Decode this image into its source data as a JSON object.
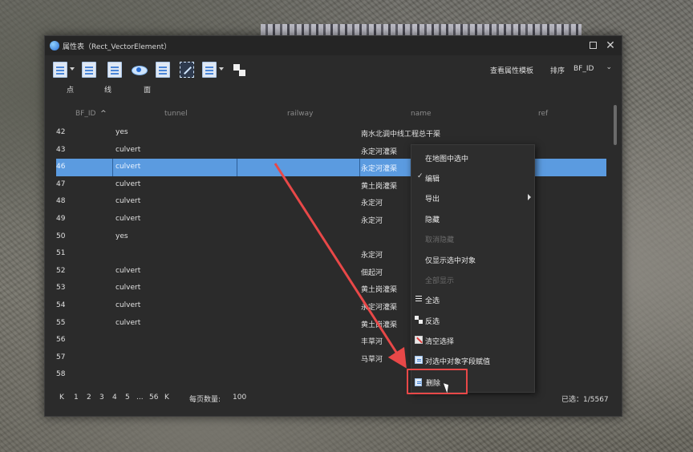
{
  "window": {
    "title": "属性表（Rect_VectorElement）"
  },
  "toolbar": {
    "labels": {
      "point": "点",
      "line": "线",
      "polygon": "面"
    },
    "view_template": "查看属性模板",
    "sort_label": "排序",
    "sort_field": "BF_ID"
  },
  "table": {
    "headers": [
      "BF_ID",
      "tunnel",
      "railway",
      "name",
      "ref"
    ],
    "rows": [
      {
        "id": "42",
        "tunnel": "yes",
        "name": "南水北调中线工程总干渠"
      },
      {
        "id": "43",
        "tunnel": "culvert",
        "name": "永定河灌渠"
      },
      {
        "id": "46",
        "tunnel": "culvert",
        "name": "永定河灌渠",
        "selected": true
      },
      {
        "id": "47",
        "tunnel": "culvert",
        "name": "黄土岗灌渠"
      },
      {
        "id": "48",
        "tunnel": "culvert",
        "name": "永定河"
      },
      {
        "id": "49",
        "tunnel": "culvert",
        "name": "永定河"
      },
      {
        "id": "50",
        "tunnel": "yes",
        "name": ""
      },
      {
        "id": "51",
        "tunnel": "",
        "name": "永定河"
      },
      {
        "id": "52",
        "tunnel": "culvert",
        "name": "佃起河"
      },
      {
        "id": "53",
        "tunnel": "culvert",
        "name": "黄土岗灌渠"
      },
      {
        "id": "54",
        "tunnel": "culvert",
        "name": "永定河灌渠"
      },
      {
        "id": "55",
        "tunnel": "culvert",
        "name": "黄土岗灌渠"
      },
      {
        "id": "56",
        "tunnel": "",
        "name": "丰草河"
      },
      {
        "id": "57",
        "tunnel": "",
        "name": "马草河"
      },
      {
        "id": "58",
        "tunnel": "",
        "name": ""
      }
    ]
  },
  "context_menu": {
    "items": [
      {
        "label": "在地图中选中"
      },
      {
        "label": "编辑",
        "checked": true
      },
      {
        "label": "导出",
        "submenu": true
      },
      {
        "label": "隐藏"
      },
      {
        "label": "取消隐藏",
        "disabled": true
      },
      {
        "label": "仅显示选中对象"
      },
      {
        "label": "全部显示",
        "disabled": true
      },
      {
        "label": "全选",
        "icon": "select-all-icon"
      },
      {
        "label": "反选",
        "icon": "invert-selection-icon"
      },
      {
        "label": "清空选择",
        "icon": "clear-selection-icon"
      },
      {
        "label": "对选中对象字段赋值",
        "icon": "assign-field-icon"
      },
      {
        "label": "删除",
        "icon": "delete-icon"
      }
    ]
  },
  "pagination": {
    "first": "K",
    "pages": [
      "1",
      "2",
      "3",
      "4",
      "5"
    ],
    "ellipsis": "...",
    "last_page": "56",
    "last": "K",
    "page_size_label": "每页数量:",
    "page_size": "100",
    "selected_count": "已选：1/5567"
  },
  "colors": {
    "selected_row": "#5b9be0",
    "highlight_box": "#e84848",
    "annotation_arrow": "#e84848"
  }
}
